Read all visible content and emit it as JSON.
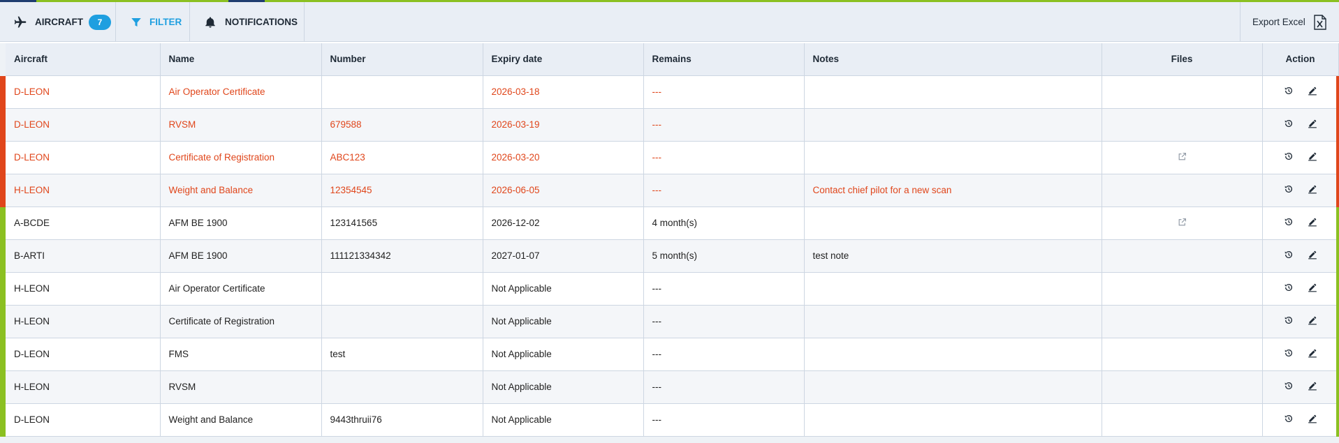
{
  "toolbar": {
    "aircraft_label": "AIRCRAFT",
    "aircraft_count": "7",
    "filter_label": "FILTER",
    "notifications_label": "NOTIFICATIONS",
    "export_label": "Export Excel",
    "icons": {
      "aircraft": "airplane-icon",
      "filter": "filter-icon",
      "notifications": "bell-icon",
      "export": "excel-icon"
    }
  },
  "colors": {
    "expired": "#e0461b",
    "valid": "#8bc021",
    "accent": "#1e9fe0",
    "header_bg": "#e9eef5"
  },
  "table": {
    "columns": [
      "Aircraft",
      "Name",
      "Number",
      "Expiry date",
      "Remains",
      "Notes",
      "Files",
      "Action"
    ],
    "rows": [
      {
        "status": "expired",
        "aircraft": "D-LEON",
        "name": "Air Operator Certificate",
        "number": "",
        "expiry": "2026-03-18",
        "remains": "---",
        "notes": "",
        "has_file": false
      },
      {
        "status": "expired",
        "aircraft": "D-LEON",
        "name": "RVSM",
        "number": "679588",
        "expiry": "2026-03-19",
        "remains": "---",
        "notes": "",
        "has_file": false
      },
      {
        "status": "expired",
        "aircraft": "D-LEON",
        "name": "Certificate of Registration",
        "number": "ABC123",
        "expiry": "2026-03-20",
        "remains": "---",
        "notes": "",
        "has_file": true
      },
      {
        "status": "expired",
        "aircraft": "H-LEON",
        "name": "Weight and Balance",
        "number": "12354545",
        "expiry": "2026-06-05",
        "remains": "---",
        "notes": "Contact chief pilot for a new scan",
        "has_file": false
      },
      {
        "status": "valid",
        "aircraft": "A-BCDE",
        "name": "AFM BE 1900",
        "number": "123141565",
        "expiry": "2026-12-02",
        "remains": "4 month(s)",
        "notes": "",
        "has_file": true
      },
      {
        "status": "valid",
        "aircraft": "B-ARTI",
        "name": "AFM BE 1900",
        "number": "111121334342",
        "expiry": "2027-01-07",
        "remains": "5 month(s)",
        "notes": "test note",
        "has_file": false
      },
      {
        "status": "valid",
        "aircraft": "H-LEON",
        "name": "Air Operator Certificate",
        "number": "",
        "expiry": "Not Applicable",
        "remains": "---",
        "notes": "",
        "has_file": false
      },
      {
        "status": "valid",
        "aircraft": "H-LEON",
        "name": "Certificate of Registration",
        "number": "",
        "expiry": "Not Applicable",
        "remains": "---",
        "notes": "",
        "has_file": false
      },
      {
        "status": "valid",
        "aircraft": "D-LEON",
        "name": "FMS",
        "number": "test",
        "expiry": "Not Applicable",
        "remains": "---",
        "notes": "",
        "has_file": false
      },
      {
        "status": "valid",
        "aircraft": "H-LEON",
        "name": "RVSM",
        "number": "",
        "expiry": "Not Applicable",
        "remains": "---",
        "notes": "",
        "has_file": false
      },
      {
        "status": "valid",
        "aircraft": "D-LEON",
        "name": "Weight and Balance",
        "number": "9443thruii76",
        "expiry": "Not Applicable",
        "remains": "---",
        "notes": "",
        "has_file": false
      }
    ],
    "row_icons": {
      "history": "history-icon",
      "edit": "edit-icon",
      "file": "external-link-icon"
    }
  }
}
